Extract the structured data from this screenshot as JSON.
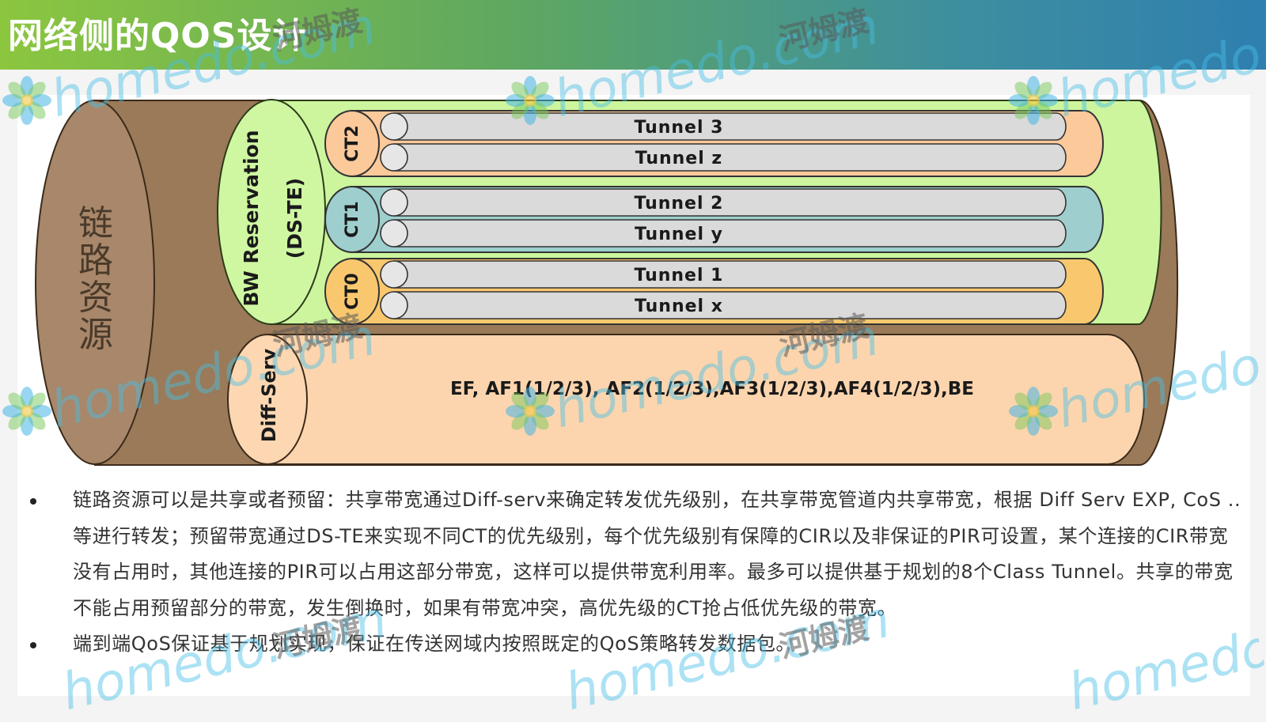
{
  "header": {
    "title": "网络侧的QOS设计"
  },
  "diagram": {
    "link_resource_label": [
      "链",
      "路",
      "资",
      "源"
    ],
    "bw_reservation_label": "BW Reservation",
    "ds_te_label": "(DS-TE)",
    "diff_serv_label": "Diff-Serv",
    "diff_serv_classes": "EF, AF1(1/2/3), AF2(1/2/3),AF3(1/2/3),AF4(1/2/3),BE",
    "class_types": [
      {
        "name": "CT2",
        "color": "#fbc99a",
        "tunnels": [
          "Tunnel 3",
          "Tunnel z"
        ]
      },
      {
        "name": "CT1",
        "color": "#9ecfce",
        "tunnels": [
          "Tunnel 2",
          "Tunnel y"
        ]
      },
      {
        "name": "CT0",
        "color": "#f9c86e",
        "tunnels": [
          "Tunnel 1",
          "Tunnel x"
        ]
      }
    ],
    "colors": {
      "outer_cylinder": "#9a7a58",
      "bw_cylinder": "#ccf59e",
      "diffserv_cylinder": "#fcd5ae",
      "tunnel_pipe": "#dadada"
    }
  },
  "bullets": [
    "链路资源可以是共享或者预留：共享带宽通过Diff-serv来确定转发优先级别，在共享带宽管道内共享带宽，根据 Diff Serv EXP, CoS ..等进行转发；预留带宽通过DS-TE来实现不同CT的优先级别，每个优先级别有保障的CIR以及非保证的PIR可设置，某个连接的CIR带宽没有占用时，其他连接的PIR可以占用这部分带宽，这样可以提供带宽利用率。最多可以提供基于规划的8个Class Tunnel。共享的带宽不能占用预留部分的带宽，发生倒换时，如果有带宽冲突，高优先级的CT抢占低优先级的带宽。",
    "端到端QoS保证基于规划实现，保证在传送网域内按照既定的QoS策略转发数据包。"
  ],
  "watermark": {
    "text_en": "homedo.com",
    "text_cn": "河姆渡"
  }
}
